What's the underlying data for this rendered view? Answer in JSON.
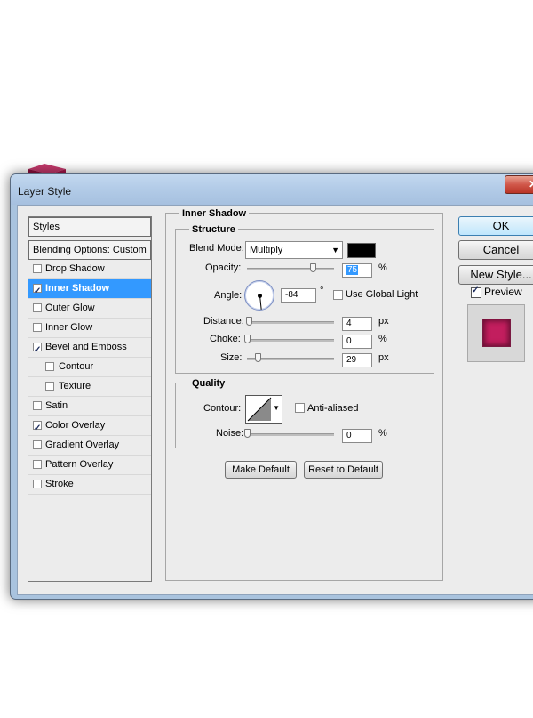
{
  "window": {
    "title": "Layer Style"
  },
  "colors": {
    "accent": "#3399ff",
    "preview": "#c21e5e",
    "shadow_color": "#000000"
  },
  "styles_list": {
    "header": "Styles",
    "blending": "Blending Options: Custom",
    "items": [
      {
        "label": "Drop Shadow",
        "checked": false,
        "active": false,
        "sub": false
      },
      {
        "label": "Inner Shadow",
        "checked": true,
        "active": true,
        "sub": false
      },
      {
        "label": "Outer Glow",
        "checked": false,
        "active": false,
        "sub": false
      },
      {
        "label": "Inner Glow",
        "checked": false,
        "active": false,
        "sub": false
      },
      {
        "label": "Bevel and Emboss",
        "checked": true,
        "active": false,
        "sub": false
      },
      {
        "label": "Contour",
        "checked": false,
        "active": false,
        "sub": true
      },
      {
        "label": "Texture",
        "checked": false,
        "active": false,
        "sub": true
      },
      {
        "label": "Satin",
        "checked": false,
        "active": false,
        "sub": false
      },
      {
        "label": "Color Overlay",
        "checked": true,
        "active": false,
        "sub": false
      },
      {
        "label": "Gradient Overlay",
        "checked": false,
        "active": false,
        "sub": false
      },
      {
        "label": "Pattern Overlay",
        "checked": false,
        "active": false,
        "sub": false
      },
      {
        "label": "Stroke",
        "checked": false,
        "active": false,
        "sub": false
      }
    ]
  },
  "panel": {
    "title": "Inner Shadow",
    "structure": {
      "title": "Structure",
      "blend_mode_label": "Blend Mode:",
      "blend_mode_value": "Multiply",
      "opacity_label": "Opacity:",
      "opacity_value": "75",
      "opacity_level": 0.75,
      "opacity_unit": "%",
      "angle_label": "Angle:",
      "angle_value": "-84",
      "angle_unit": "°",
      "global_light_label": "Use Global Light",
      "global_light_checked": false,
      "distance_label": "Distance:",
      "distance_value": "4",
      "distance_level": 0.02,
      "distance_unit": "px",
      "choke_label": "Choke:",
      "choke_value": "0",
      "choke_level": 0.0,
      "choke_unit": "%",
      "size_label": "Size:",
      "size_value": "29",
      "size_level": 0.12,
      "size_unit": "px"
    },
    "quality": {
      "title": "Quality",
      "contour_label": "Contour:",
      "anti_aliased_label": "Anti-aliased",
      "anti_aliased_checked": false,
      "noise_label": "Noise:",
      "noise_value": "0",
      "noise_level": 0.0,
      "noise_unit": "%"
    },
    "make_default": "Make Default",
    "reset_default": "Reset to Default"
  },
  "buttons": {
    "ok": "OK",
    "cancel": "Cancel",
    "new_style": "New Style...",
    "preview_label": "Preview",
    "preview_checked": true
  },
  "icons": {
    "close": "close-icon",
    "dropdown": "chevron-down-icon",
    "check": "check-icon"
  }
}
